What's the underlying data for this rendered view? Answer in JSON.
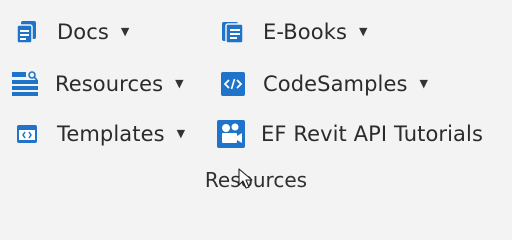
{
  "ribbon_group": {
    "label": "Resources",
    "buttons": [
      {
        "id": "docs",
        "label": "Docs",
        "icon": "docs-icon",
        "has_dropdown": true
      },
      {
        "id": "ebooks",
        "label": "E-Books",
        "icon": "ebooks-icon",
        "has_dropdown": true
      },
      {
        "id": "resources",
        "label": "Resources",
        "icon": "resources-icon",
        "has_dropdown": true
      },
      {
        "id": "codesamples",
        "label": "CodeSamples",
        "icon": "code-icon",
        "has_dropdown": true
      },
      {
        "id": "templates",
        "label": "Templates",
        "icon": "template-icon",
        "has_dropdown": true
      },
      {
        "id": "tutorials",
        "label": "EF Revit API Tutorials",
        "icon": "video-icon",
        "has_dropdown": false
      }
    ],
    "dropdown_glyph": "▼"
  },
  "colors": {
    "icon_blue": "#1f73c8",
    "background": "#f3f3f3",
    "text": "#2b2b2b"
  }
}
